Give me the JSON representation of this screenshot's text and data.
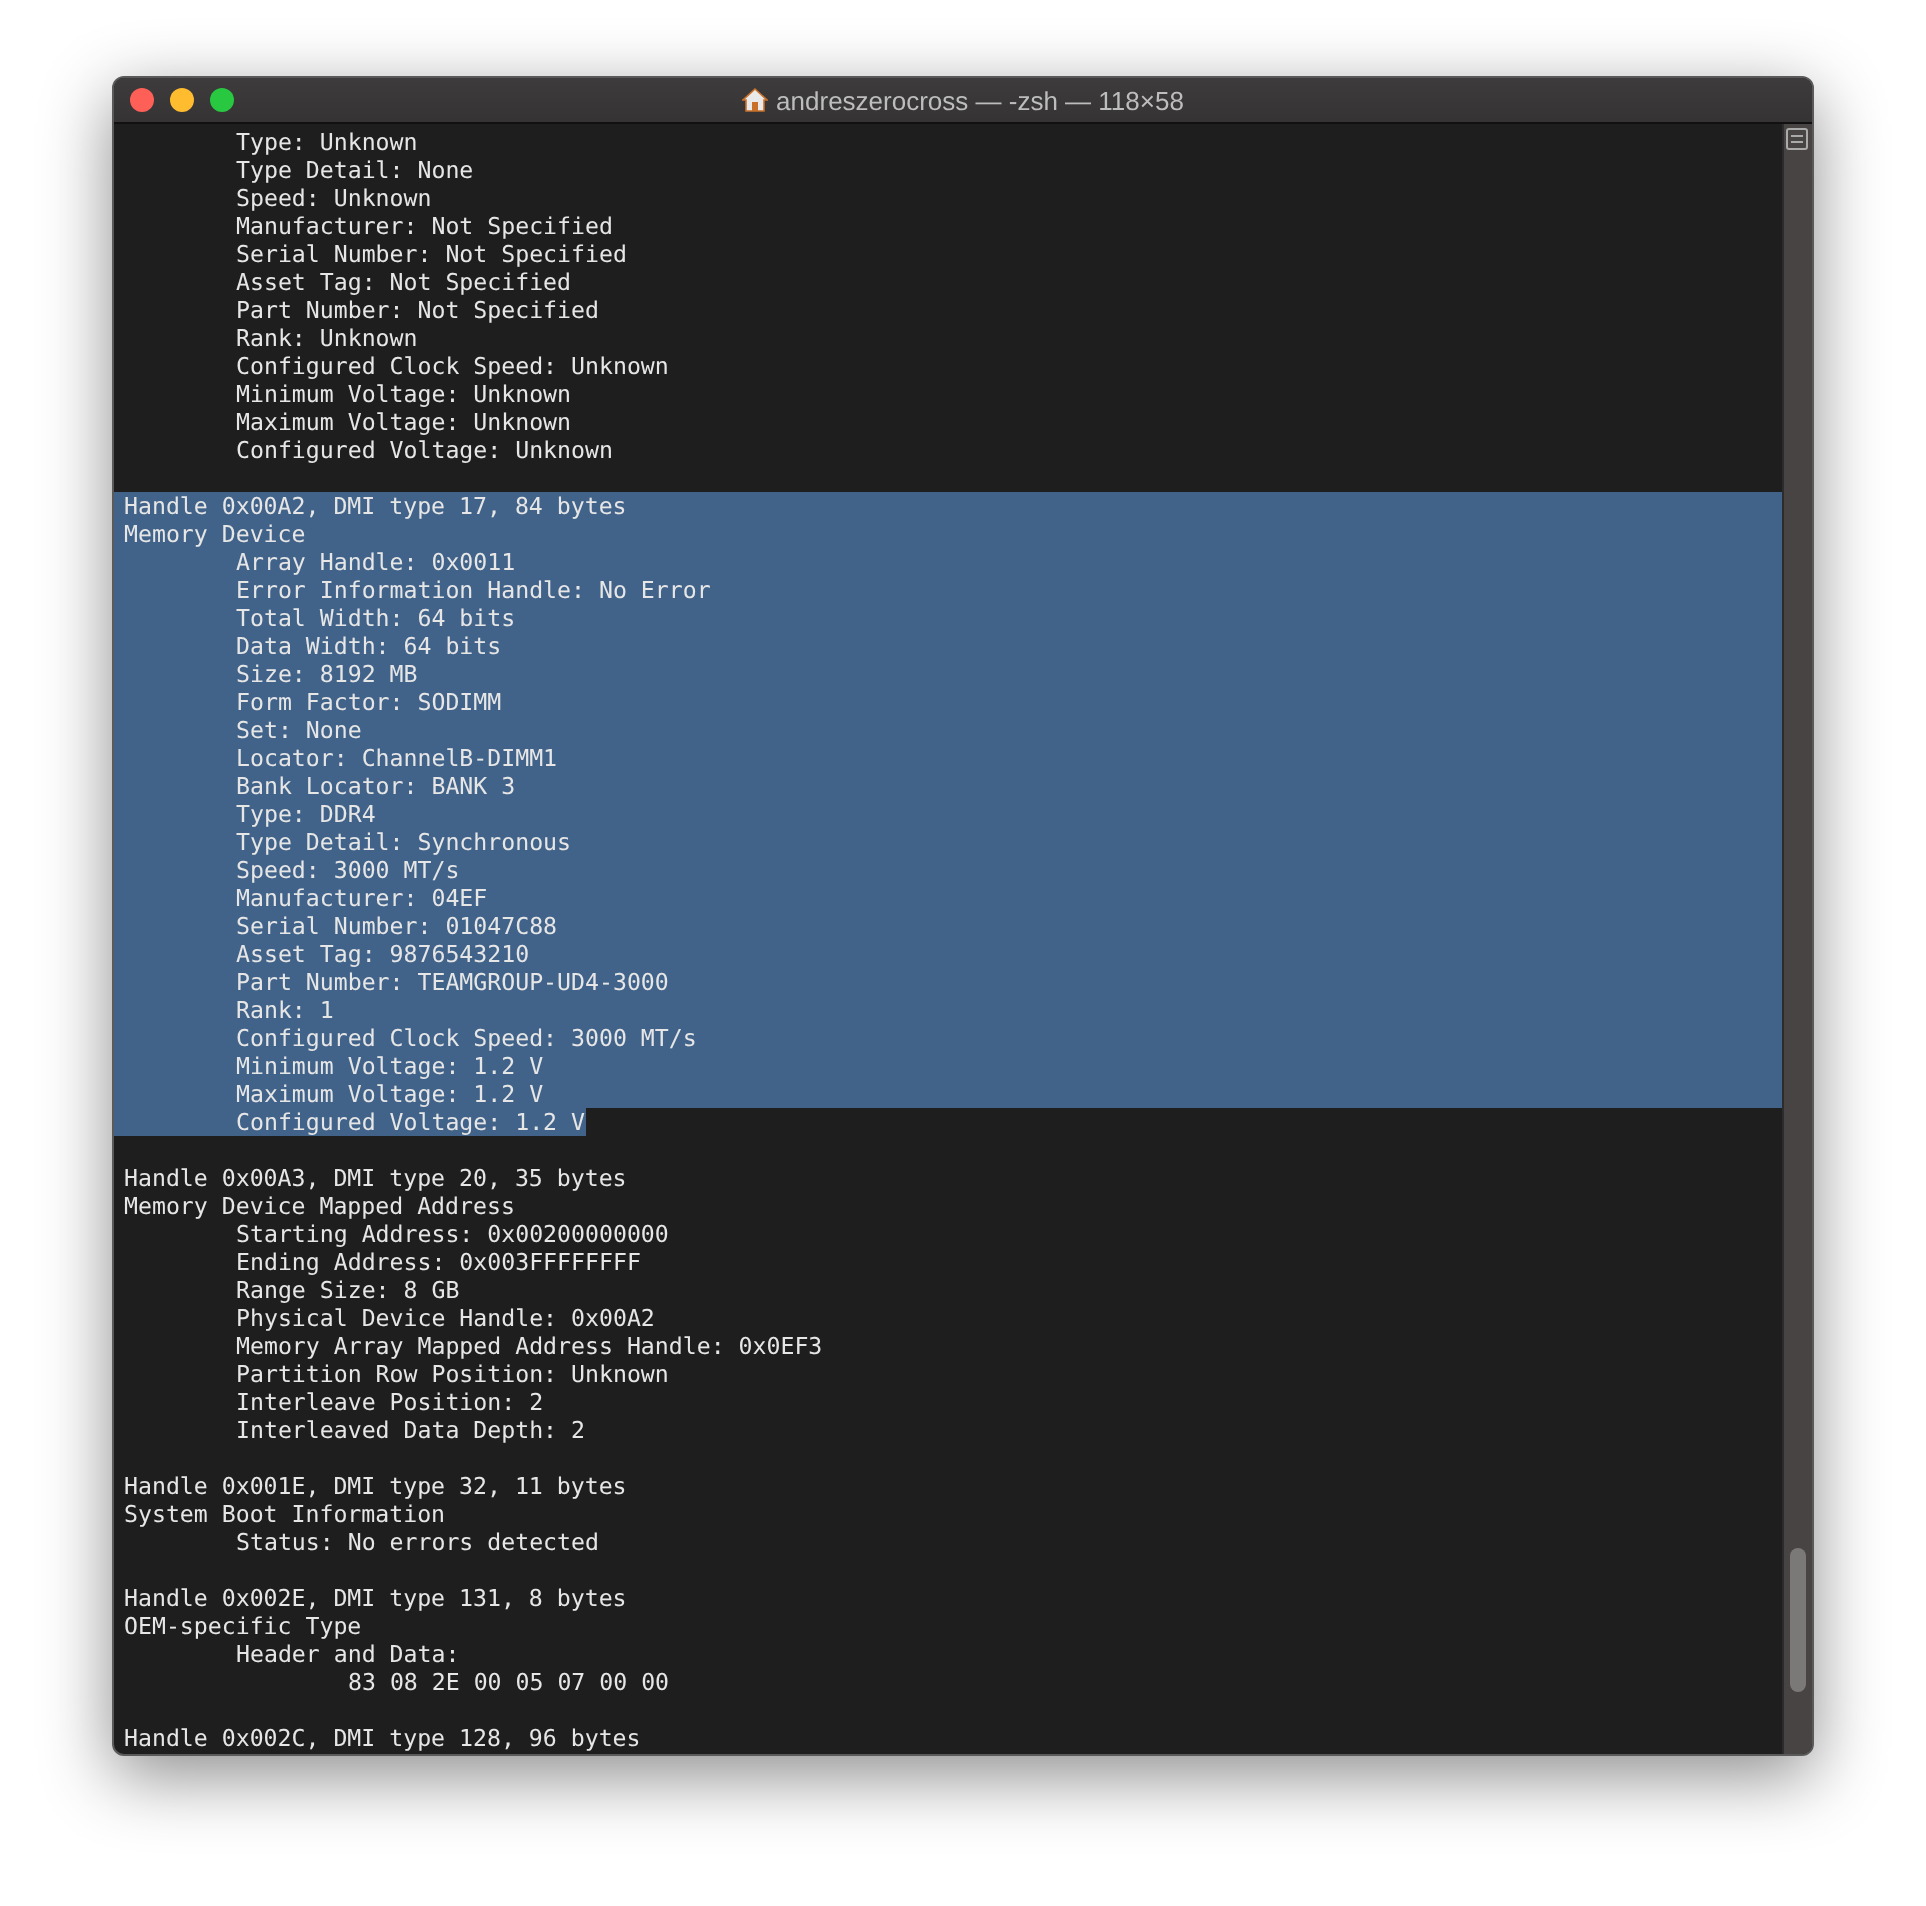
{
  "window": {
    "title": "andreszerocross — -zsh — 118×58"
  },
  "blocks": [
    {
      "fields": [
        {
          "text": "Type: Unknown",
          "selected": false
        },
        {
          "text": "Type Detail: None",
          "selected": false
        },
        {
          "text": "Speed: Unknown",
          "selected": false
        },
        {
          "text": "Manufacturer: Not Specified",
          "selected": false
        },
        {
          "text": "Serial Number: Not Specified",
          "selected": false
        },
        {
          "text": "Asset Tag: Not Specified",
          "selected": false
        },
        {
          "text": "Part Number: Not Specified",
          "selected": false
        },
        {
          "text": "Rank: Unknown",
          "selected": false
        },
        {
          "text": "Configured Clock Speed: Unknown",
          "selected": false
        },
        {
          "text": "Minimum Voltage: Unknown",
          "selected": false
        },
        {
          "text": "Maximum Voltage: Unknown",
          "selected": false
        },
        {
          "text": "Configured Voltage: Unknown",
          "selected": false
        }
      ]
    },
    {
      "header": {
        "text": "Handle 0x00A2, DMI type 17, 84 bytes",
        "selected": true
      },
      "title": {
        "text": "Memory Device",
        "selected": true
      },
      "fields": [
        {
          "text": "Array Handle: 0x0011",
          "selected": true
        },
        {
          "text": "Error Information Handle: No Error",
          "selected": true
        },
        {
          "text": "Total Width: 64 bits",
          "selected": true
        },
        {
          "text": "Data Width: 64 bits",
          "selected": true
        },
        {
          "text": "Size: 8192 MB",
          "selected": true
        },
        {
          "text": "Form Factor: SODIMM",
          "selected": true
        },
        {
          "text": "Set: None",
          "selected": true
        },
        {
          "text": "Locator: ChannelB-DIMM1",
          "selected": true
        },
        {
          "text": "Bank Locator: BANK 3",
          "selected": true
        },
        {
          "text": "Type: DDR4",
          "selected": true
        },
        {
          "text": "Type Detail: Synchronous",
          "selected": true
        },
        {
          "text": "Speed: 3000 MT/s",
          "selected": true
        },
        {
          "text": "Manufacturer: 04EF",
          "selected": true
        },
        {
          "text": "Serial Number: 01047C88",
          "selected": true
        },
        {
          "text": "Asset Tag: 9876543210",
          "selected": true
        },
        {
          "text": "Part Number: TEAMGROUP-UD4-3000",
          "selected": true
        },
        {
          "text": "Rank: 1",
          "selected": true
        },
        {
          "text": "Configured Clock Speed: 3000 MT/s",
          "selected": true
        },
        {
          "text": "Minimum Voltage: 1.2 V",
          "selected": true
        },
        {
          "text": "Maximum Voltage: 1.2 V",
          "selected": true
        },
        {
          "text": "Configured Voltage: 1.2 V",
          "selected": true
        }
      ]
    },
    {
      "header": {
        "text": "Handle 0x00A3, DMI type 20, 35 bytes",
        "selected": false
      },
      "title": {
        "text": "Memory Device Mapped Address",
        "selected": false
      },
      "fields": [
        {
          "text": "Starting Address: 0x00200000000",
          "selected": false
        },
        {
          "text": "Ending Address: 0x003FFFFFFFF",
          "selected": false
        },
        {
          "text": "Range Size: 8 GB",
          "selected": false
        },
        {
          "text": "Physical Device Handle: 0x00A2",
          "selected": false
        },
        {
          "text": "Memory Array Mapped Address Handle: 0x0EF3",
          "selected": false
        },
        {
          "text": "Partition Row Position: Unknown",
          "selected": false
        },
        {
          "text": "Interleave Position: 2",
          "selected": false
        },
        {
          "text": "Interleaved Data Depth: 2",
          "selected": false
        }
      ]
    },
    {
      "header": {
        "text": "Handle 0x001E, DMI type 32, 11 bytes",
        "selected": false
      },
      "title": {
        "text": "System Boot Information",
        "selected": false
      },
      "fields": [
        {
          "text": "Status: No errors detected",
          "selected": false
        }
      ]
    },
    {
      "header": {
        "text": "Handle 0x002E, DMI type 131, 8 bytes",
        "selected": false
      },
      "title": {
        "text": "OEM-specific Type",
        "selected": false
      },
      "fields": [
        {
          "text": "Header and Data:",
          "selected": false,
          "children": [
            {
              "text": "83 08 2E 00 05 07 00 00",
              "selected": false
            }
          ]
        }
      ]
    },
    {
      "header": {
        "text": "Handle 0x002C, DMI type 128, 96 bytes",
        "selected": false
      }
    }
  ]
}
